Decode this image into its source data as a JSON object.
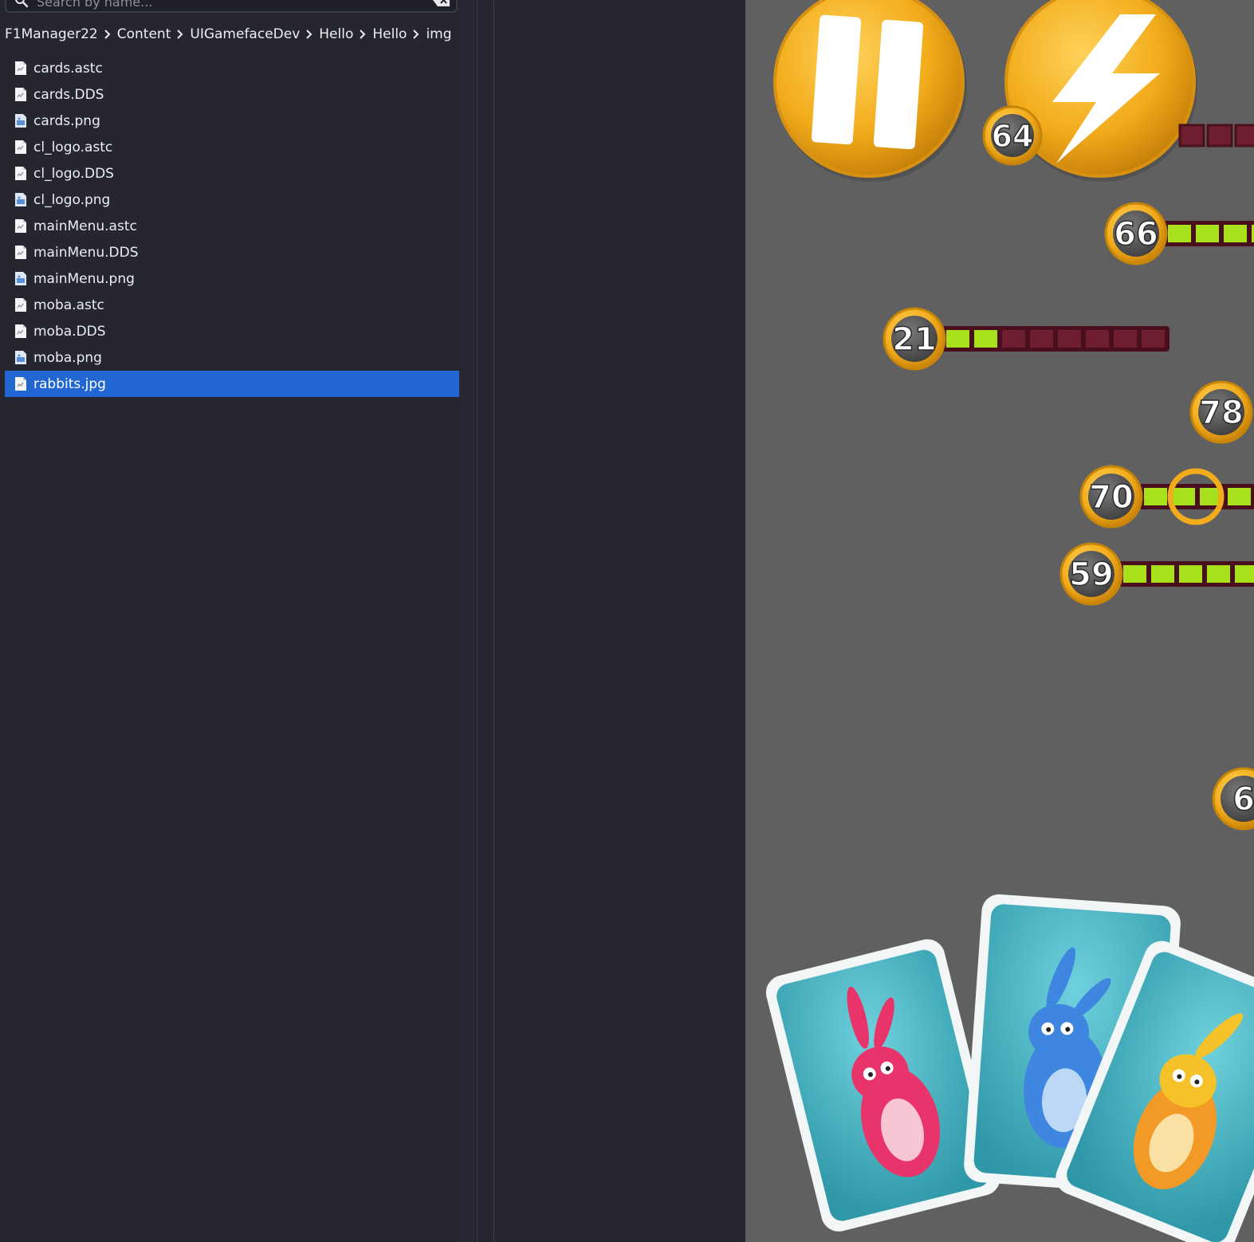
{
  "search": {
    "placeholder": "Search by name..."
  },
  "breadcrumb": [
    "F1Manager22",
    "Content",
    "UIGamefaceDev",
    "Hello",
    "Hello",
    "img"
  ],
  "files": [
    {
      "name": "cards.astc",
      "type": "generic"
    },
    {
      "name": "cards.DDS",
      "type": "generic"
    },
    {
      "name": "cards.png",
      "type": "image"
    },
    {
      "name": "cl_logo.astc",
      "type": "generic"
    },
    {
      "name": "cl_logo.DDS",
      "type": "generic"
    },
    {
      "name": "cl_logo.png",
      "type": "image"
    },
    {
      "name": "mainMenu.astc",
      "type": "generic"
    },
    {
      "name": "mainMenu.DDS",
      "type": "generic"
    },
    {
      "name": "mainMenu.png",
      "type": "image"
    },
    {
      "name": "moba.astc",
      "type": "generic"
    },
    {
      "name": "moba.DDS",
      "type": "generic"
    },
    {
      "name": "moba.png",
      "type": "image"
    },
    {
      "name": "rabbits.jpg",
      "type": "generic",
      "selected": true
    }
  ],
  "preview": {
    "badges": [
      {
        "label": "64"
      },
      {
        "label": "66"
      },
      {
        "label": "21"
      },
      {
        "label": "78"
      },
      {
        "label": "70"
      },
      {
        "label": "59"
      },
      {
        "label": "6"
      }
    ],
    "colors": {
      "background": "#606060",
      "gold": "#f2ac1b",
      "bar_fill": "#a8e11c",
      "bar_empty": "#6e1e2e",
      "card": "#44b3c4"
    }
  },
  "colors": {
    "panel": "#252630",
    "selection": "#2166d3",
    "text": "#eceef2"
  }
}
